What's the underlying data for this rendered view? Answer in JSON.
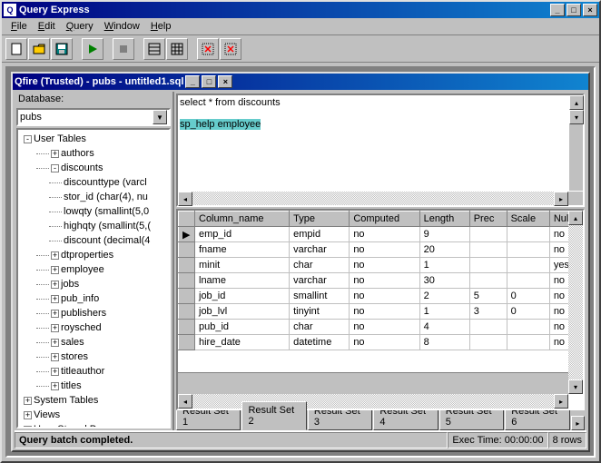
{
  "app_title": "Query Express",
  "menus": [
    "File",
    "Edit",
    "Query",
    "Window",
    "Help"
  ],
  "inner_title": "fire (Trusted) - pubs - untitled1.sql",
  "database": {
    "label": "Database:",
    "value": "pubs"
  },
  "tree": [
    {
      "level": 1,
      "expand": "-",
      "label": "User Tables"
    },
    {
      "level": 2,
      "expand": "+",
      "label": "authors"
    },
    {
      "level": 2,
      "expand": "-",
      "label": "discounts"
    },
    {
      "level": 3,
      "expand": "",
      "label": "discounttype (varcl"
    },
    {
      "level": 3,
      "expand": "",
      "label": "stor_id (char(4), nu"
    },
    {
      "level": 3,
      "expand": "",
      "label": "lowqty (smallint(5,0"
    },
    {
      "level": 3,
      "expand": "",
      "label": "highqty (smallint(5,("
    },
    {
      "level": 3,
      "expand": "",
      "label": "discount (decimal(4"
    },
    {
      "level": 2,
      "expand": "+",
      "label": "dtproperties"
    },
    {
      "level": 2,
      "expand": "+",
      "label": "employee"
    },
    {
      "level": 2,
      "expand": "+",
      "label": "jobs"
    },
    {
      "level": 2,
      "expand": "+",
      "label": "pub_info"
    },
    {
      "level": 2,
      "expand": "+",
      "label": "publishers"
    },
    {
      "level": 2,
      "expand": "+",
      "label": "roysched"
    },
    {
      "level": 2,
      "expand": "+",
      "label": "sales"
    },
    {
      "level": 2,
      "expand": "+",
      "label": "stores"
    },
    {
      "level": 2,
      "expand": "+",
      "label": "titleauthor"
    },
    {
      "level": 2,
      "expand": "+",
      "label": "titles"
    },
    {
      "level": 1,
      "expand": "+",
      "label": "System Tables"
    },
    {
      "level": 1,
      "expand": "+",
      "label": "Views"
    },
    {
      "level": 1,
      "expand": "+",
      "label": "User Stored Procs"
    }
  ],
  "sql": {
    "line1": "select * from discounts",
    "line2": "sp_help employee"
  },
  "grid": {
    "headers": [
      "Column_name",
      "Type",
      "Computed",
      "Length",
      "Prec",
      "Scale",
      "Null"
    ],
    "rows": [
      [
        "emp_id",
        "empid",
        "no",
        "9",
        "",
        "",
        "no"
      ],
      [
        "fname",
        "varchar",
        "no",
        "20",
        "",
        "",
        "no"
      ],
      [
        "minit",
        "char",
        "no",
        "1",
        "",
        "",
        "yes"
      ],
      [
        "lname",
        "varchar",
        "no",
        "30",
        "",
        "",
        "no"
      ],
      [
        "job_id",
        "smallint",
        "no",
        "2",
        "5",
        "0",
        "no"
      ],
      [
        "job_lvl",
        "tinyint",
        "no",
        "1",
        "3",
        "0",
        "no"
      ],
      [
        "pub_id",
        "char",
        "no",
        "4",
        "",
        "",
        "no"
      ],
      [
        "hire_date",
        "datetime",
        "no",
        "8",
        "",
        "",
        "no"
      ]
    ]
  },
  "tabs": [
    "Result Set 1",
    "Result Set 2",
    "Result Set 3",
    "Result Set 4",
    "Result Set 5",
    "Result Set 6"
  ],
  "active_tab": 1,
  "status": {
    "msg": "Query batch completed.",
    "time_label": "Exec Time: 00:00:00",
    "rows": "8 rows"
  }
}
